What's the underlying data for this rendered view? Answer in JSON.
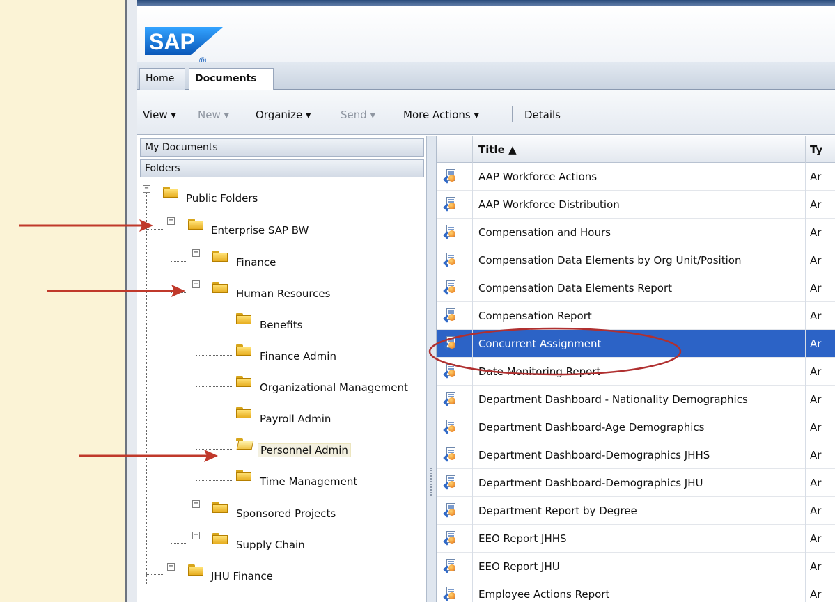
{
  "brand": {
    "logo_text": "SAP",
    "registered": "®"
  },
  "tabs": [
    {
      "label": "Home",
      "active": false
    },
    {
      "label": "Documents",
      "active": true
    }
  ],
  "toolbar": {
    "view": "View ▾",
    "new": "New ▾",
    "organize": "Organize ▾",
    "send": "Send ▾",
    "more_actions": "More Actions ▾",
    "details": "Details"
  },
  "left_pane": {
    "my_documents": "My Documents",
    "folders": "Folders",
    "tree": {
      "public_folders": "Public Folders",
      "enterprise_sap_bw": "Enterprise SAP BW",
      "finance": "Finance",
      "human_resources": "Human Resources",
      "benefits": "Benefits",
      "finance_admin": "Finance Admin",
      "organizational_management": "Organizational Management",
      "payroll_admin": "Payroll Admin",
      "personnel_admin": "Personnel Admin",
      "time_management": "Time Management",
      "sponsored_projects": "Sponsored Projects",
      "supply_chain": "Supply Chain",
      "jhu_finance": "JHU Finance"
    }
  },
  "grid": {
    "columns": {
      "title": "Title ▲",
      "type": "Ty"
    },
    "rows": [
      {
        "title": "AAP Workforce Actions",
        "type": "Ar"
      },
      {
        "title": "AAP Workforce Distribution",
        "type": "Ar"
      },
      {
        "title": "Compensation and Hours",
        "type": "Ar"
      },
      {
        "title": "Compensation Data Elements by Org Unit/Position",
        "type": "Ar"
      },
      {
        "title": "Compensation Data Elements Report",
        "type": "Ar"
      },
      {
        "title": "Compensation Report",
        "type": "Ar"
      },
      {
        "title": "Concurrent Assignment",
        "type": "Ar",
        "selected": true
      },
      {
        "title": "Date Monitoring Report",
        "type": "Ar"
      },
      {
        "title": "Department Dashboard - Nationality Demographics",
        "type": "Ar"
      },
      {
        "title": "Department Dashboard-Age Demographics",
        "type": "Ar"
      },
      {
        "title": "Department Dashboard-Demographics JHHS",
        "type": "Ar"
      },
      {
        "title": "Department Dashboard-Demographics JHU",
        "type": "Ar"
      },
      {
        "title": "Department Report by Degree",
        "type": "Ar"
      },
      {
        "title": "EEO Report JHHS",
        "type": "Ar"
      },
      {
        "title": "EEO Report JHU",
        "type": "Ar"
      },
      {
        "title": "Employee Actions Report",
        "type": "Ar"
      }
    ]
  },
  "colors": {
    "background": "#fbf3d6",
    "selection": "#2c63c6",
    "annotation_red": "#c0392b",
    "sap_blue": "#0a6ed1",
    "folder_yellow": "#f0c040"
  }
}
